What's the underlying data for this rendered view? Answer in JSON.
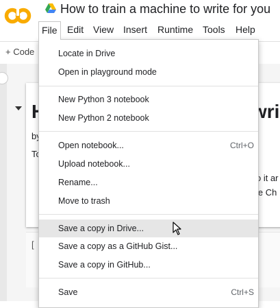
{
  "header": {
    "title": "How to train a machine to write for you",
    "logo_icon": "colab-logo",
    "drive_icon": "google-drive-icon"
  },
  "menubar": {
    "items": [
      "File",
      "Edit",
      "View",
      "Insert",
      "Runtime",
      "Tools",
      "Help"
    ],
    "active": "File"
  },
  "toolbar": {
    "code_label": "+ Code"
  },
  "background": {
    "heading_fragment": "H",
    "heading_fragment_right": "wri",
    "line1_left": "by",
    "line2_left": "To",
    "line3_right": "o it ar",
    "line4_right": "le Ch",
    "cell_bracket": "["
  },
  "file_menu": {
    "items": [
      {
        "label": "Locate in Drive",
        "shortcut": ""
      },
      {
        "label": "Open in playground mode",
        "shortcut": ""
      },
      {
        "label": "New Python 3 notebook",
        "shortcut": ""
      },
      {
        "label": "New Python 2 notebook",
        "shortcut": ""
      },
      {
        "label": "Open notebook...",
        "shortcut": "Ctrl+O"
      },
      {
        "label": "Upload notebook...",
        "shortcut": ""
      },
      {
        "label": "Rename...",
        "shortcut": ""
      },
      {
        "label": "Move to trash",
        "shortcut": ""
      },
      {
        "label": "Save a copy in Drive...",
        "shortcut": ""
      },
      {
        "label": "Save a copy as a GitHub Gist...",
        "shortcut": ""
      },
      {
        "label": "Save a copy in GitHub...",
        "shortcut": ""
      },
      {
        "label": "Save",
        "shortcut": "Ctrl+S"
      }
    ],
    "hovered": "Save a copy in Drive..."
  },
  "colors": {
    "logo_orange": "#F9AB00",
    "hover_gray": "#e6e6e6",
    "menu_border": "#c8c8c8"
  }
}
